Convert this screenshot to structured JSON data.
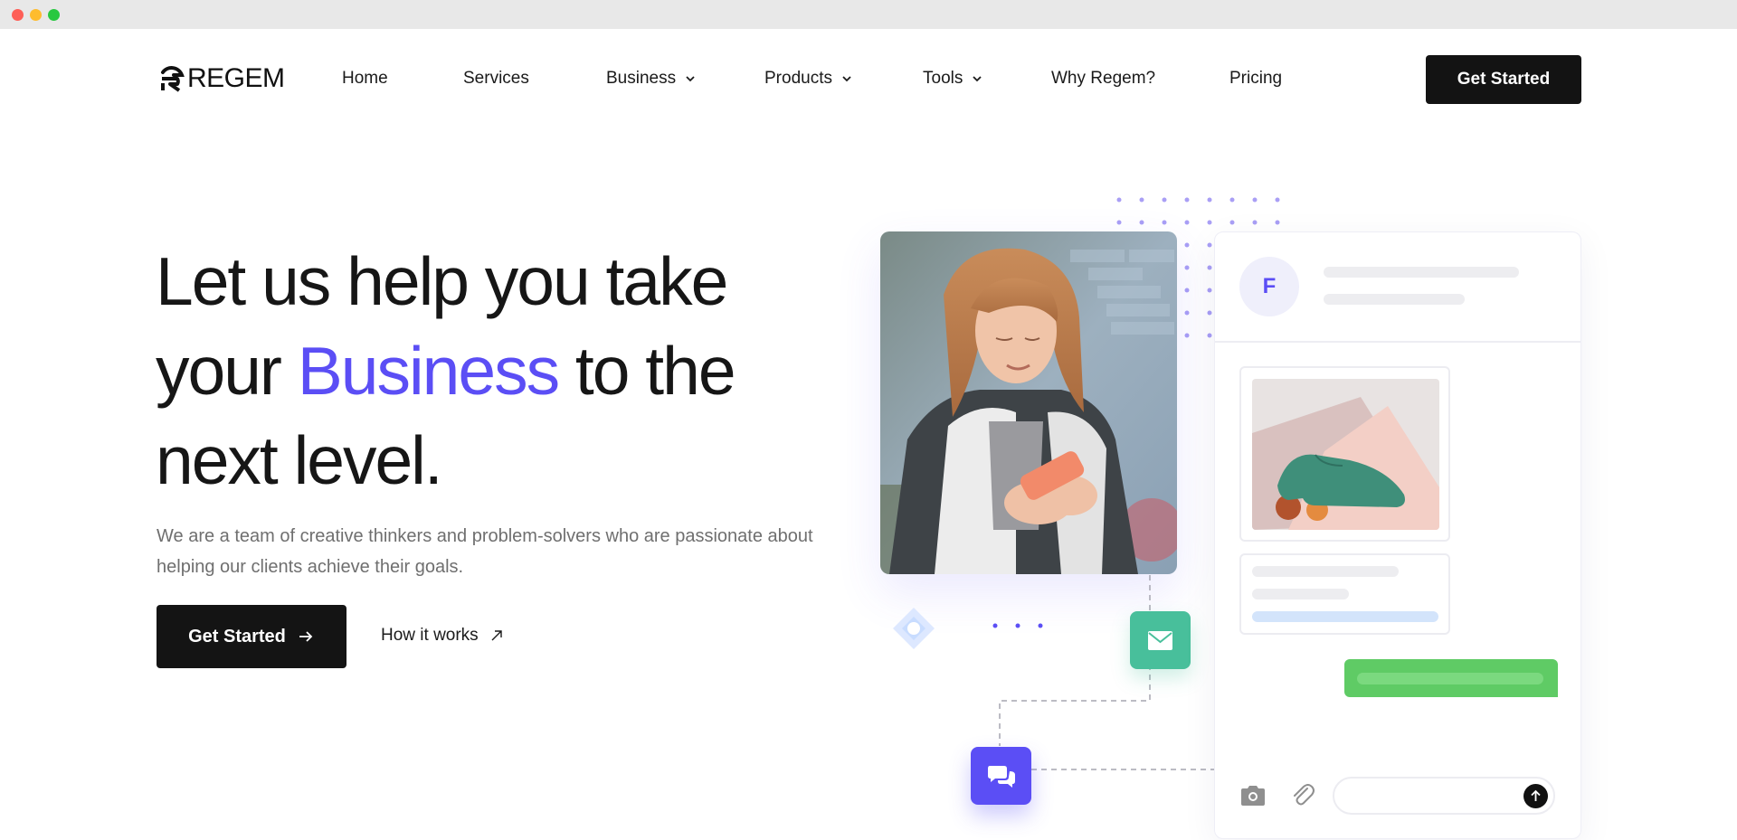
{
  "window": {
    "controls": [
      "close",
      "minimize",
      "maximize"
    ]
  },
  "brand": {
    "logo_text": "REGEM",
    "logo_icon": "regem-r-logo"
  },
  "nav": {
    "items": [
      {
        "label": "Home",
        "has_dropdown": false
      },
      {
        "label": "Services",
        "has_dropdown": false
      },
      {
        "label": "Business",
        "has_dropdown": true
      },
      {
        "label": "Products",
        "has_dropdown": true
      },
      {
        "label": "Tools",
        "has_dropdown": true
      },
      {
        "label": "Why Regem?",
        "has_dropdown": false
      },
      {
        "label": "Pricing",
        "has_dropdown": false
      }
    ],
    "cta_label": "Get Started"
  },
  "hero": {
    "headline_part1": "Let us help you take",
    "headline_part2": "your ",
    "headline_accent": "Business",
    "headline_part3": " to the",
    "headline_part4": "next level.",
    "subtext": "We are a team of creative thinkers and problem-solvers who are passionate about helping our clients achieve their goals.",
    "primary_cta": "Get Started",
    "secondary_cta": "How it works"
  },
  "illustration": {
    "chat_avatar_initial": "F",
    "icons": [
      "mail-icon",
      "chat-bubbles-icon",
      "camera-icon",
      "paperclip-icon",
      "send-arrow-icon"
    ]
  },
  "colors": {
    "accent": "#5b4ef5",
    "dark": "#131313",
    "mint": "#48bf9b",
    "sent_bubble": "#5fcb65",
    "text_muted": "#6f6f6f"
  }
}
